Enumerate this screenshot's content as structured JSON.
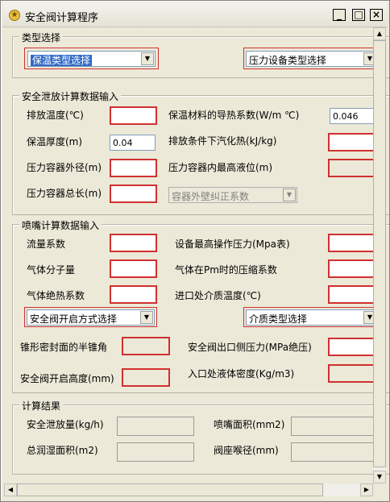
{
  "window": {
    "title": "安全阀计算程序",
    "minimize_glyph": "_",
    "maximize_glyph": "□",
    "close_glyph": "×"
  },
  "type_group": {
    "label": "类型选择",
    "insulation_type": "保温类型选择",
    "vessel_type": "压力设备类型选择"
  },
  "discharge_group": {
    "label": "安全泄放计算数据输入",
    "discharge_temp": {
      "label": "排放温度(℃)",
      "value": ""
    },
    "thermal_conductivity": {
      "label": "保温材料的导热系数(W/m ℃)",
      "value": "0.046"
    },
    "insulation_thickness": {
      "label": "保温厚度(m)",
      "value": "0.04"
    },
    "latent_heat": {
      "label": "排放条件下汽化热(kJ/kg)",
      "value": ""
    },
    "vessel_od": {
      "label": "压力容器外径(m)",
      "value": ""
    },
    "max_liquid_level": {
      "label": "压力容器内最高液位(m)",
      "value": ""
    },
    "vessel_length": {
      "label": "压力容器总长(m)",
      "value": ""
    },
    "wall_correction": "容器外壁纠正系数"
  },
  "nozzle_group": {
    "label": "喷嘴计算数据输入",
    "flow_coef": {
      "label": "流量系数",
      "value": ""
    },
    "max_pressure": {
      "label": "设备最高操作压力(Mpa表)",
      "value": ""
    },
    "molecular_weight": {
      "label": "气体分子量",
      "value": ""
    },
    "compress_factor": {
      "label": "气体在Pm时的压缩系数",
      "value": ""
    },
    "adiabatic_coef": {
      "label": "气体绝热系数",
      "value": ""
    },
    "inlet_temp": {
      "label": "进口处介质温度(℃)",
      "value": ""
    },
    "open_mode": "安全阀开启方式选择",
    "medium_type": "介质类型选择",
    "cone_half_angle": {
      "label": "锥形密封面的半锥角",
      "value": ""
    },
    "outlet_pressure": {
      "label": "安全阀出口侧压力(MPa绝压)",
      "value": ""
    },
    "lift_height": {
      "label": "安全阀开启高度(mm)",
      "value": ""
    },
    "liquid_density": {
      "label": "入口处液体密度(Kg/m3)",
      "value": ""
    }
  },
  "results_group": {
    "label": "计算结果",
    "discharge_rate": {
      "label": "安全泄放量(kg/h)",
      "value": ""
    },
    "nozzle_area": {
      "label": "喷嘴面积(mm2)",
      "value": ""
    },
    "wetted_area": {
      "label": "总润湿面积(m2)",
      "value": ""
    },
    "throat_diameter": {
      "label": "阀座喉径(mm)",
      "value": ""
    }
  },
  "icons": {
    "app": "app-icon",
    "dropdown": "chevron-down-icon"
  },
  "colors": {
    "highlight": "#316ac5",
    "required_border": "#d03030",
    "face": "#ece9d8"
  }
}
